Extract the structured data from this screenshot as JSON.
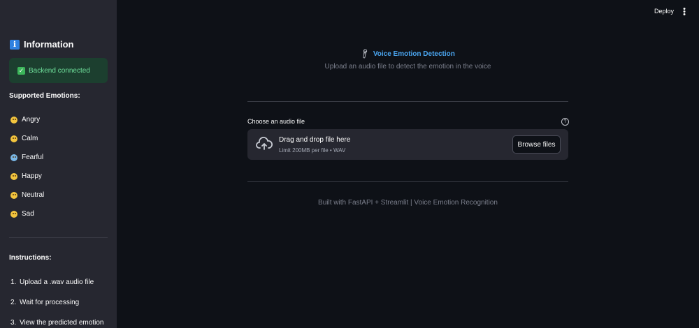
{
  "header": {
    "deploy_label": "Deploy",
    "menu_icon": "kebab-menu-icon"
  },
  "sidebar": {
    "title": "Information",
    "title_icon": "info-icon",
    "status": "Backend connected",
    "status_icon": "check-icon",
    "emotions_heading": "Supported Emotions:",
    "emotions": [
      {
        "label": "Angry",
        "icon": "angry-face-icon"
      },
      {
        "label": "Calm",
        "icon": "calm-face-icon"
      },
      {
        "label": "Fearful",
        "icon": "fearful-face-icon"
      },
      {
        "label": "Happy",
        "icon": "happy-face-icon"
      },
      {
        "label": "Neutral",
        "icon": "neutral-face-icon"
      },
      {
        "label": "Sad",
        "icon": "sad-face-icon"
      }
    ],
    "instructions_heading": "Instructions:",
    "instructions": [
      {
        "num": "1.",
        "text": "Upload a .wav audio file"
      },
      {
        "num": "2.",
        "text": "Wait for processing"
      },
      {
        "num": "3.",
        "text": "View the predicted emotion"
      }
    ]
  },
  "main": {
    "title": "Voice Emotion Detection",
    "title_icon": "microphone-icon",
    "subtitle": "Upload an audio file to detect the emotion in the voice",
    "upload": {
      "label": "Choose an audio file",
      "drop_title": "Drag and drop file here",
      "drop_hint": "Limit 200MB per file • WAV",
      "browse_label": "Browse files"
    },
    "footer": "Built with FastAPI + Streamlit | Voice Emotion Recognition"
  },
  "colors": {
    "background": "#0e1117",
    "sidebar": "#262730",
    "accent_title": "#4aa5f0",
    "success_bg": "#1c3f2f",
    "success_text": "#6fe09b"
  }
}
